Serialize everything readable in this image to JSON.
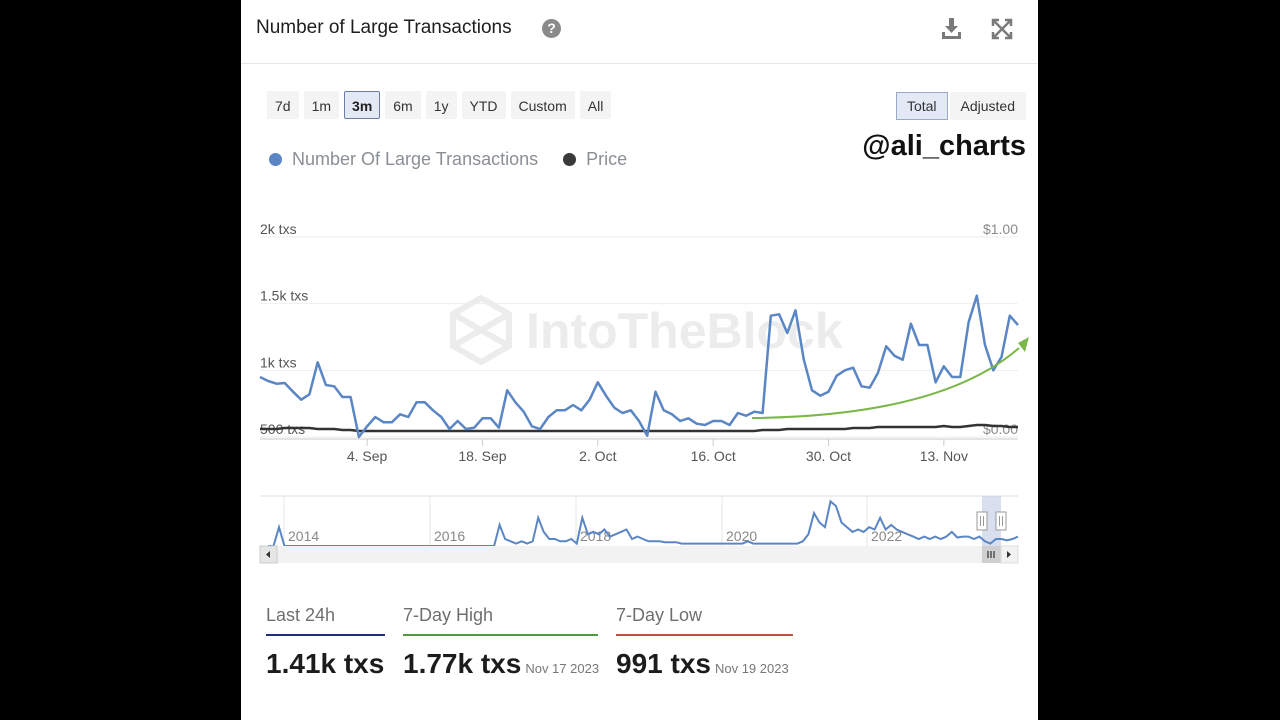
{
  "header": {
    "title": "Number of Large Transactions",
    "help_icon": "question-circle-icon",
    "download_icon": "download-icon",
    "fullscreen_icon": "expand-arrows-icon"
  },
  "range_buttons": [
    {
      "label": "7d",
      "active": false
    },
    {
      "label": "1m",
      "active": false
    },
    {
      "label": "3m",
      "active": true
    },
    {
      "label": "6m",
      "active": false
    },
    {
      "label": "1y",
      "active": false
    },
    {
      "label": "YTD",
      "active": false
    },
    {
      "label": "Custom",
      "active": false
    },
    {
      "label": "All",
      "active": false
    }
  ],
  "mode_toggle": [
    {
      "label": "Total",
      "active": true
    },
    {
      "label": "Adjusted",
      "active": false
    }
  ],
  "overlay_handle": "@ali_charts",
  "watermark": "IntoTheBlock",
  "colors": {
    "transactions": "#5b86c5",
    "price": "#333333",
    "trend_arrow": "#7ab648",
    "last24": "#1f2f7a",
    "high": "#4e9a3a",
    "low": "#b8553f"
  },
  "chart_data": {
    "type": "line",
    "title": "Number of Large Transactions",
    "legend": [
      "Number Of Large Transactions",
      "Price"
    ],
    "legend_position": "top-left",
    "y_left": {
      "ticks": [
        "2k txs",
        "1.5k txs",
        "1k txs",
        "500 txs"
      ],
      "tick_values": [
        2000,
        1500,
        1000,
        500
      ],
      "range": [
        500,
        2000
      ]
    },
    "y_right": {
      "ticks": [
        "$1.00",
        "$0.00"
      ],
      "tick_values": [
        1,
        0
      ],
      "range": [
        0,
        1
      ]
    },
    "x_ticks": [
      "4. Sep",
      "18. Sep",
      "2. Oct",
      "16. Oct",
      "30. Oct",
      "13. Nov"
    ],
    "x_tick_day_index": [
      13,
      27,
      41,
      55,
      69,
      83
    ],
    "x_day_count": 92,
    "grid": true,
    "series": [
      {
        "name": "Number Of Large Transactions",
        "values": [
          950,
          920,
          900,
          905,
          840,
          780,
          820,
          1060,
          890,
          880,
          800,
          800,
          500,
          580,
          650,
          610,
          610,
          670,
          650,
          760,
          760,
          700,
          650,
          560,
          620,
          560,
          570,
          640,
          640,
          570,
          850,
          760,
          690,
          580,
          560,
          650,
          700,
          700,
          740,
          700,
          780,
          910,
          810,
          720,
          680,
          700,
          620,
          510,
          840,
          700,
          670,
          620,
          640,
          600,
          590,
          620,
          620,
          590,
          680,
          660,
          690,
          680,
          1410,
          1420,
          1280,
          1450,
          1080,
          850,
          810,
          840,
          960,
          1000,
          1020,
          880,
          870,
          980,
          1180,
          1110,
          1080,
          1350,
          1190,
          1190,
          910,
          1030,
          950,
          950,
          1360,
          1560,
          1190,
          1000,
          1100,
          1410,
          1340
        ],
        "color": "#5b86c5"
      },
      {
        "name": "Price",
        "values": [
          0.04,
          0.04,
          0.04,
          0.045,
          0.045,
          0.045,
          0.045,
          0.04,
          0.04,
          0.04,
          0.035,
          0.035,
          0.03,
          0.03,
          0.03,
          0.03,
          0.03,
          0.03,
          0.03,
          0.03,
          0.03,
          0.03,
          0.03,
          0.03,
          0.03,
          0.03,
          0.03,
          0.03,
          0.03,
          0.03,
          0.03,
          0.03,
          0.03,
          0.03,
          0.03,
          0.03,
          0.03,
          0.03,
          0.03,
          0.03,
          0.03,
          0.03,
          0.03,
          0.03,
          0.03,
          0.03,
          0.03,
          0.03,
          0.03,
          0.03,
          0.03,
          0.03,
          0.03,
          0.03,
          0.03,
          0.03,
          0.03,
          0.03,
          0.03,
          0.03,
          0.03,
          0.035,
          0.035,
          0.035,
          0.04,
          0.04,
          0.04,
          0.04,
          0.04,
          0.04,
          0.04,
          0.04,
          0.045,
          0.045,
          0.045,
          0.05,
          0.05,
          0.05,
          0.05,
          0.05,
          0.05,
          0.05,
          0.05,
          0.055,
          0.05,
          0.05,
          0.055,
          0.06,
          0.06,
          0.055,
          0.055,
          0.05,
          0.05
        ],
        "color": "#333333"
      }
    ],
    "annotation": "green upward trend arrow from ~20 Oct to ~22 Nov"
  },
  "navigator": {
    "year_labels": [
      "2014",
      "2016",
      "2018",
      "2020",
      "2022"
    ],
    "values": [
      0,
      0,
      40,
      0,
      0,
      0,
      0,
      0,
      0,
      0,
      0,
      0,
      0,
      0,
      0,
      0,
      0,
      0,
      0,
      0,
      0,
      0,
      0,
      0,
      0,
      0,
      0,
      0,
      0,
      0,
      0,
      0,
      0,
      0,
      0,
      0,
      0,
      0,
      0,
      0,
      0,
      0,
      45,
      15,
      10,
      5,
      10,
      5,
      10,
      60,
      30,
      15,
      15,
      10,
      10,
      15,
      5,
      60,
      25,
      30,
      25,
      35,
      20,
      25,
      30,
      35,
      15,
      20,
      15,
      10,
      10,
      10,
      8,
      8,
      8,
      5,
      5,
      5,
      5,
      5,
      5,
      5,
      5,
      5,
      5,
      5,
      5,
      10,
      5,
      5,
      5,
      5,
      5,
      5,
      5,
      5,
      5,
      10,
      25,
      70,
      50,
      40,
      95,
      85,
      50,
      40,
      30,
      35,
      30,
      40,
      35,
      60,
      35,
      45,
      35,
      30,
      25,
      20,
      15,
      20,
      15,
      20,
      15,
      20,
      30,
      18,
      20,
      20,
      15,
      20,
      10,
      5,
      15,
      15,
      12,
      15,
      20
    ],
    "selected_range": "last 3 months"
  },
  "stats": [
    {
      "label": "Last 24h",
      "value": "1.41k txs",
      "date": "",
      "color_key": "last24"
    },
    {
      "label": "7-Day High",
      "value": "1.77k txs",
      "date": "Nov 17 2023",
      "color_key": "high"
    },
    {
      "label": "7-Day Low",
      "value": "991 txs",
      "date": "Nov 19 2023",
      "color_key": "low"
    }
  ]
}
